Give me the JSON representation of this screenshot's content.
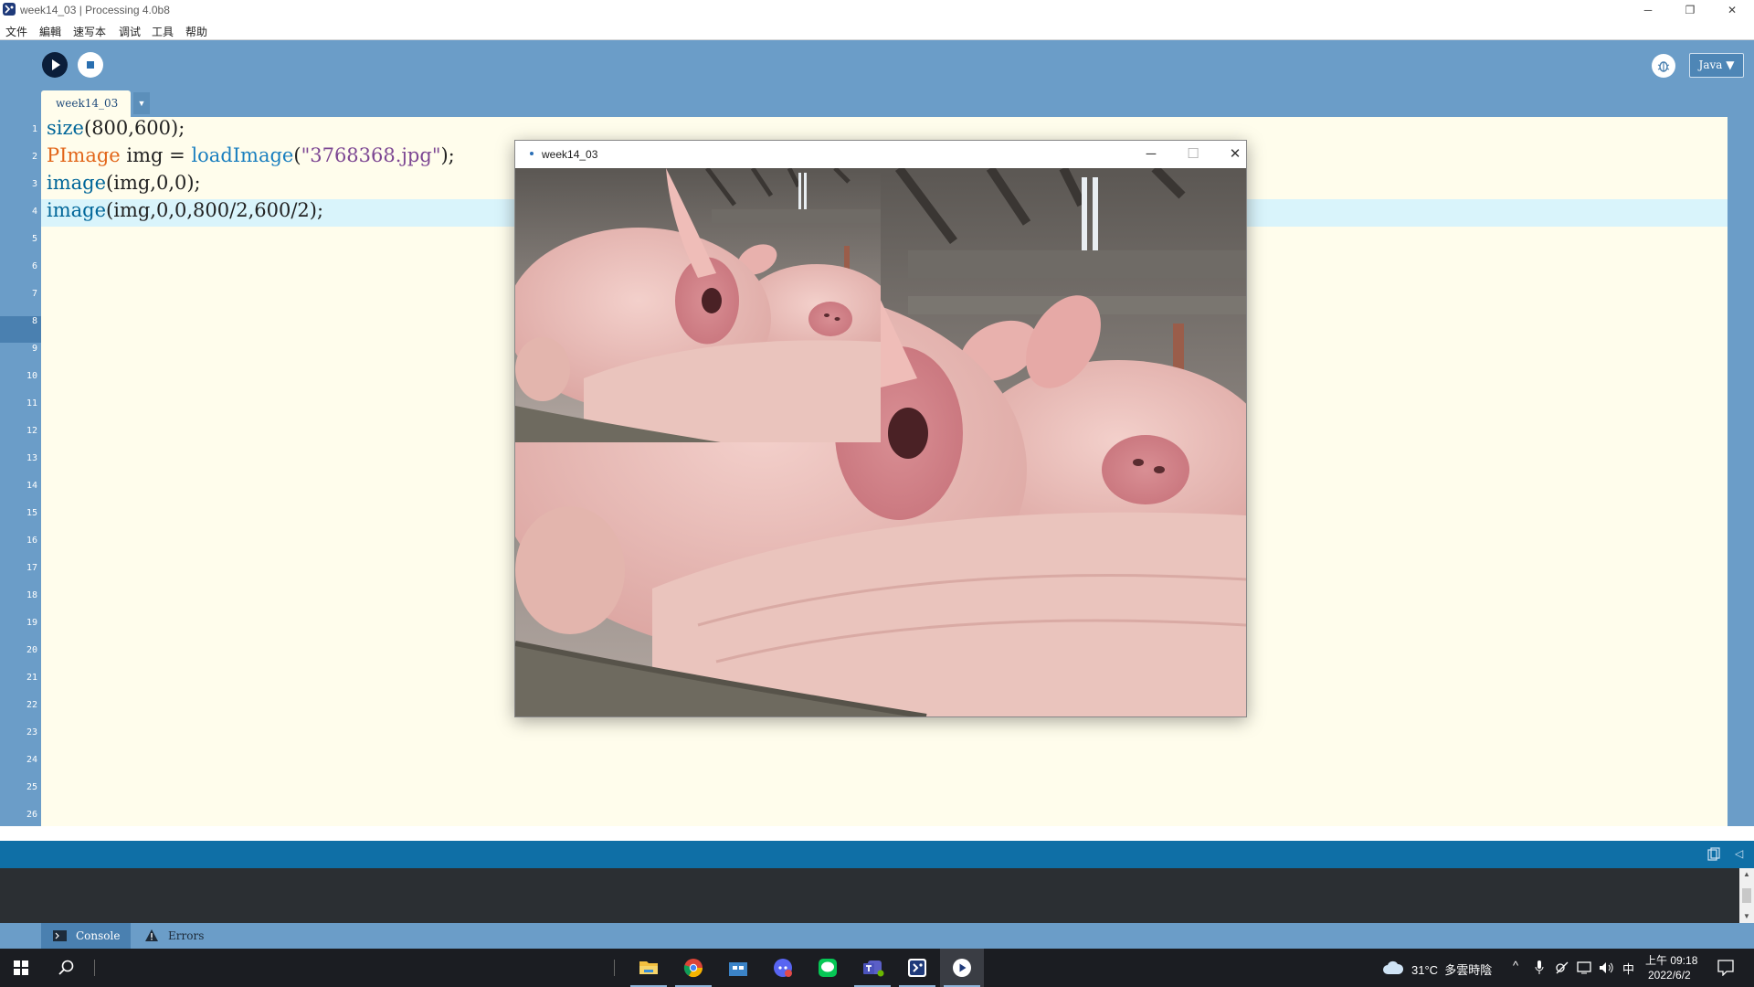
{
  "window": {
    "title": "week14_03 | Processing 4.0b8",
    "controls": [
      "minimize",
      "restore",
      "close"
    ]
  },
  "menu": [
    "文件",
    "編輯",
    "速写本",
    "调试",
    "工具",
    "帮助"
  ],
  "toolbar": {
    "run_icon": "play-icon",
    "stop_icon": "stop-icon",
    "mode": "Java ▼"
  },
  "tab": {
    "label": "week14_03",
    "menu_glyph": "▼"
  },
  "editor": {
    "line_count": 26,
    "current_line": 4,
    "code": [
      "size(800,600);",
      "PImage img = loadImage(\"3768368.jpg\");",
      "image(img,0,0);",
      "image(img,0,0,800/2,600/2);"
    ]
  },
  "sketch": {
    "title": "week14_03",
    "image_file": "3768368.jpg",
    "canvas_size": "800 × 600"
  },
  "bottom_tabs": {
    "console": "Console",
    "errors": "Errors"
  },
  "taskbar": {
    "apps": [
      "file-explorer-icon",
      "chrome-icon",
      "store-icon",
      "discord-icon",
      "line-icon",
      "teams-icon",
      "processing-icon",
      "processing-sketch-icon"
    ],
    "weather": "31°C  多雲時陰",
    "ime": "中",
    "time": "上午 09:18",
    "date": "2022/6/2"
  },
  "colors": {
    "toolbar": "#6b9dc8",
    "editor_bg": "#fffdec",
    "status_bar": "#0f6fa6",
    "console_bg": "#2b2f33",
    "taskbar": "#1b1d22"
  }
}
